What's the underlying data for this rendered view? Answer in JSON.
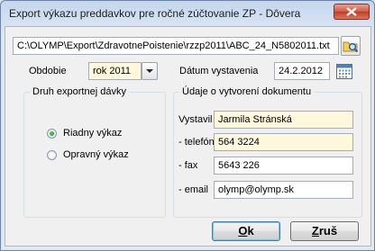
{
  "window": {
    "title": "Export výkazu preddavkov pre ročné zúčtovanie ZP - Dôvera"
  },
  "file_path": "C:\\OLYMP\\Export\\ZdravotnePoistenie\\rzzp2011\\ABC_24_N5802011.txt",
  "obdobie": {
    "label": "Obdobie",
    "value": "rok 2011"
  },
  "datum": {
    "label": "Dátum vystavenia",
    "value": "24.2.2012"
  },
  "druh": {
    "title": "Druh exportnej dávky",
    "options": [
      {
        "label": "Riadny výkaz",
        "checked": true
      },
      {
        "label": "Opravný výkaz",
        "checked": false
      }
    ]
  },
  "udaje": {
    "title": "Údaje o vytvorení dokumentu",
    "vystavil": {
      "label": "Vystavil",
      "value": "Jarmila Stránská"
    },
    "telefon": {
      "label": "- telefón",
      "value": "564 3224"
    },
    "fax": {
      "label": "- fax",
      "value": "5643 226"
    },
    "email": {
      "label": "- email",
      "value": "olymp@olymp.sk"
    }
  },
  "buttons": {
    "ok_prefix": "O",
    "ok_rest": "k",
    "cancel_prefix": "Z",
    "cancel_rest": "ruš"
  },
  "icons": {
    "browse": "folder-search-icon",
    "calendar": "calendar-icon",
    "dropdown": "chevron-down-icon",
    "close": "close-icon"
  }
}
